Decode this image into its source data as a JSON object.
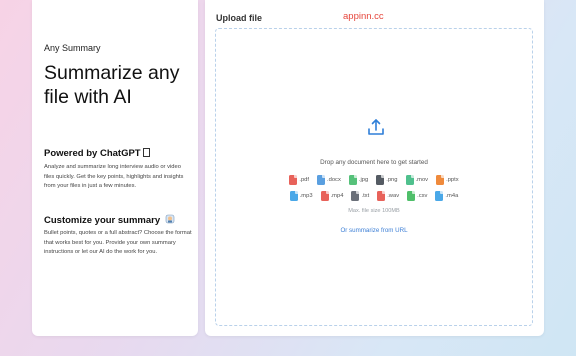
{
  "left": {
    "eyebrow": "Any Summary",
    "headline": "Summarize any file with AI",
    "section1": {
      "title": "Powered by ChatGPT",
      "text": "Analyze and summarize long interview audio or video files quickly. Get the key points, highlights and insights from your files in just a few minutes."
    },
    "section2": {
      "title": "Customize your summary",
      "text": "Bullet points, quotes or a full abstract? Choose the format that works best for you. Provide your own summary instructions or let our AI do the work for you."
    }
  },
  "right": {
    "upload_label": "Upload file",
    "watermark": "appinn.cc",
    "drop_text": "Drop any document here to get started",
    "file_types_row1": [
      {
        "label": ".pdf",
        "color": "#e8625a"
      },
      {
        "label": ".docx",
        "color": "#5a9fe0"
      },
      {
        "label": ".jpg",
        "color": "#56c17a"
      },
      {
        "label": ".png",
        "color": "#555b63"
      },
      {
        "label": ".mov",
        "color": "#4fc08d"
      },
      {
        "label": ".pptx",
        "color": "#ef8a3c"
      }
    ],
    "file_types_row2": [
      {
        "label": ".mp3",
        "color": "#4aa8e8"
      },
      {
        "label": ".mp4",
        "color": "#e8625a"
      },
      {
        "label": ".txt",
        "color": "#6b7079"
      },
      {
        "label": ".wav",
        "color": "#e8625a"
      },
      {
        "label": ".csv",
        "color": "#4fbf6a"
      },
      {
        "label": ".m4a",
        "color": "#4aa8e8"
      }
    ],
    "max_size": "Max. file size 100MB",
    "url_link": "Or summarize from URL"
  },
  "colors": {
    "accent": "#2f7fd8",
    "watermark": "#e6463c"
  }
}
